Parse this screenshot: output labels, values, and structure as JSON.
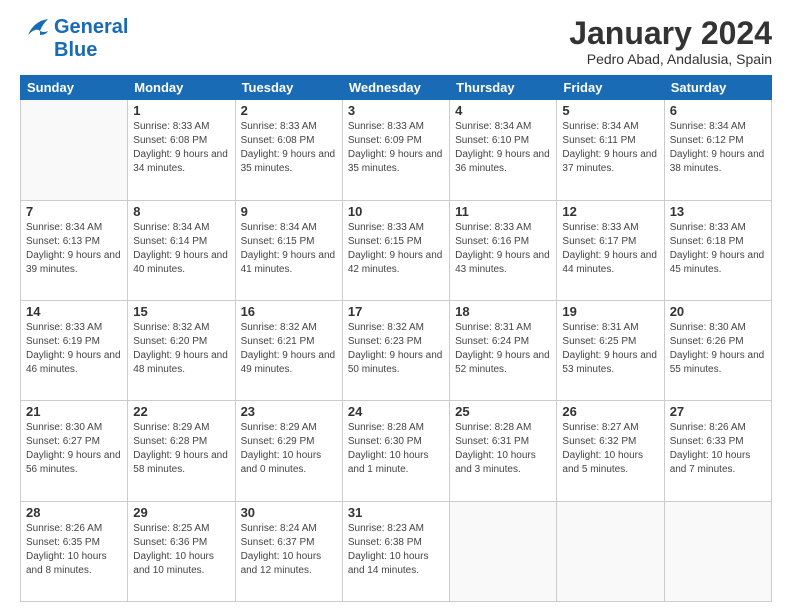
{
  "header": {
    "logo": {
      "line1": "General",
      "line2": "Blue"
    },
    "title": "January 2024",
    "location": "Pedro Abad, Andalusia, Spain"
  },
  "days_of_week": [
    "Sunday",
    "Monday",
    "Tuesday",
    "Wednesday",
    "Thursday",
    "Friday",
    "Saturday"
  ],
  "weeks": [
    [
      {
        "day": "",
        "sunrise": "",
        "sunset": "",
        "daylight": "",
        "empty": true
      },
      {
        "day": "1",
        "sunrise": "Sunrise: 8:33 AM",
        "sunset": "Sunset: 6:08 PM",
        "daylight": "Daylight: 9 hours and 34 minutes."
      },
      {
        "day": "2",
        "sunrise": "Sunrise: 8:33 AM",
        "sunset": "Sunset: 6:08 PM",
        "daylight": "Daylight: 9 hours and 35 minutes."
      },
      {
        "day": "3",
        "sunrise": "Sunrise: 8:33 AM",
        "sunset": "Sunset: 6:09 PM",
        "daylight": "Daylight: 9 hours and 35 minutes."
      },
      {
        "day": "4",
        "sunrise": "Sunrise: 8:34 AM",
        "sunset": "Sunset: 6:10 PM",
        "daylight": "Daylight: 9 hours and 36 minutes."
      },
      {
        "day": "5",
        "sunrise": "Sunrise: 8:34 AM",
        "sunset": "Sunset: 6:11 PM",
        "daylight": "Daylight: 9 hours and 37 minutes."
      },
      {
        "day": "6",
        "sunrise": "Sunrise: 8:34 AM",
        "sunset": "Sunset: 6:12 PM",
        "daylight": "Daylight: 9 hours and 38 minutes."
      }
    ],
    [
      {
        "day": "7",
        "sunrise": "Sunrise: 8:34 AM",
        "sunset": "Sunset: 6:13 PM",
        "daylight": "Daylight: 9 hours and 39 minutes."
      },
      {
        "day": "8",
        "sunrise": "Sunrise: 8:34 AM",
        "sunset": "Sunset: 6:14 PM",
        "daylight": "Daylight: 9 hours and 40 minutes."
      },
      {
        "day": "9",
        "sunrise": "Sunrise: 8:34 AM",
        "sunset": "Sunset: 6:15 PM",
        "daylight": "Daylight: 9 hours and 41 minutes."
      },
      {
        "day": "10",
        "sunrise": "Sunrise: 8:33 AM",
        "sunset": "Sunset: 6:15 PM",
        "daylight": "Daylight: 9 hours and 42 minutes."
      },
      {
        "day": "11",
        "sunrise": "Sunrise: 8:33 AM",
        "sunset": "Sunset: 6:16 PM",
        "daylight": "Daylight: 9 hours and 43 minutes."
      },
      {
        "day": "12",
        "sunrise": "Sunrise: 8:33 AM",
        "sunset": "Sunset: 6:17 PM",
        "daylight": "Daylight: 9 hours and 44 minutes."
      },
      {
        "day": "13",
        "sunrise": "Sunrise: 8:33 AM",
        "sunset": "Sunset: 6:18 PM",
        "daylight": "Daylight: 9 hours and 45 minutes."
      }
    ],
    [
      {
        "day": "14",
        "sunrise": "Sunrise: 8:33 AM",
        "sunset": "Sunset: 6:19 PM",
        "daylight": "Daylight: 9 hours and 46 minutes."
      },
      {
        "day": "15",
        "sunrise": "Sunrise: 8:32 AM",
        "sunset": "Sunset: 6:20 PM",
        "daylight": "Daylight: 9 hours and 48 minutes."
      },
      {
        "day": "16",
        "sunrise": "Sunrise: 8:32 AM",
        "sunset": "Sunset: 6:21 PM",
        "daylight": "Daylight: 9 hours and 49 minutes."
      },
      {
        "day": "17",
        "sunrise": "Sunrise: 8:32 AM",
        "sunset": "Sunset: 6:23 PM",
        "daylight": "Daylight: 9 hours and 50 minutes."
      },
      {
        "day": "18",
        "sunrise": "Sunrise: 8:31 AM",
        "sunset": "Sunset: 6:24 PM",
        "daylight": "Daylight: 9 hours and 52 minutes."
      },
      {
        "day": "19",
        "sunrise": "Sunrise: 8:31 AM",
        "sunset": "Sunset: 6:25 PM",
        "daylight": "Daylight: 9 hours and 53 minutes."
      },
      {
        "day": "20",
        "sunrise": "Sunrise: 8:30 AM",
        "sunset": "Sunset: 6:26 PM",
        "daylight": "Daylight: 9 hours and 55 minutes."
      }
    ],
    [
      {
        "day": "21",
        "sunrise": "Sunrise: 8:30 AM",
        "sunset": "Sunset: 6:27 PM",
        "daylight": "Daylight: 9 hours and 56 minutes."
      },
      {
        "day": "22",
        "sunrise": "Sunrise: 8:29 AM",
        "sunset": "Sunset: 6:28 PM",
        "daylight": "Daylight: 9 hours and 58 minutes."
      },
      {
        "day": "23",
        "sunrise": "Sunrise: 8:29 AM",
        "sunset": "Sunset: 6:29 PM",
        "daylight": "Daylight: 10 hours and 0 minutes."
      },
      {
        "day": "24",
        "sunrise": "Sunrise: 8:28 AM",
        "sunset": "Sunset: 6:30 PM",
        "daylight": "Daylight: 10 hours and 1 minute."
      },
      {
        "day": "25",
        "sunrise": "Sunrise: 8:28 AM",
        "sunset": "Sunset: 6:31 PM",
        "daylight": "Daylight: 10 hours and 3 minutes."
      },
      {
        "day": "26",
        "sunrise": "Sunrise: 8:27 AM",
        "sunset": "Sunset: 6:32 PM",
        "daylight": "Daylight: 10 hours and 5 minutes."
      },
      {
        "day": "27",
        "sunrise": "Sunrise: 8:26 AM",
        "sunset": "Sunset: 6:33 PM",
        "daylight": "Daylight: 10 hours and 7 minutes."
      }
    ],
    [
      {
        "day": "28",
        "sunrise": "Sunrise: 8:26 AM",
        "sunset": "Sunset: 6:35 PM",
        "daylight": "Daylight: 10 hours and 8 minutes."
      },
      {
        "day": "29",
        "sunrise": "Sunrise: 8:25 AM",
        "sunset": "Sunset: 6:36 PM",
        "daylight": "Daylight: 10 hours and 10 minutes."
      },
      {
        "day": "30",
        "sunrise": "Sunrise: 8:24 AM",
        "sunset": "Sunset: 6:37 PM",
        "daylight": "Daylight: 10 hours and 12 minutes."
      },
      {
        "day": "31",
        "sunrise": "Sunrise: 8:23 AM",
        "sunset": "Sunset: 6:38 PM",
        "daylight": "Daylight: 10 hours and 14 minutes."
      },
      {
        "day": "",
        "sunrise": "",
        "sunset": "",
        "daylight": "",
        "empty": true
      },
      {
        "day": "",
        "sunrise": "",
        "sunset": "",
        "daylight": "",
        "empty": true
      },
      {
        "day": "",
        "sunrise": "",
        "sunset": "",
        "daylight": "",
        "empty": true
      }
    ]
  ]
}
